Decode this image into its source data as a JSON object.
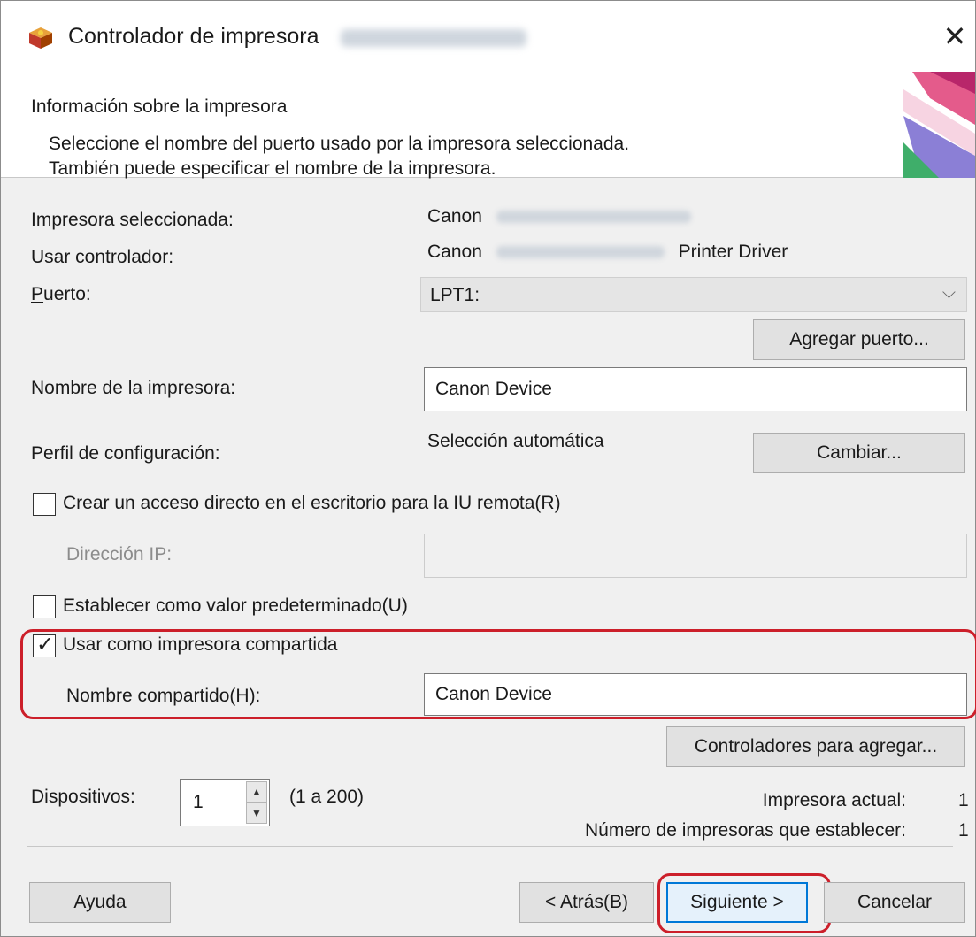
{
  "window": {
    "title": "Controlador de impresora",
    "close_glyph": "✕"
  },
  "header": {
    "title": "Información sobre la impresora",
    "desc_line1": "Seleccione el nombre del puerto usado por la impresora seleccionada.",
    "desc_line2": "También puede especificar el nombre de la impresora."
  },
  "form": {
    "selected_printer_label": "Impresora seleccionada:",
    "selected_printer_value": "Canon",
    "driver_label": "Usar controlador:",
    "driver_value_prefix": "Canon",
    "driver_value_suffix": "Printer Driver",
    "port_label": "Puerto:",
    "port_value": "LPT1:",
    "add_port_button": "Agregar puerto...",
    "printer_name_label": "Nombre de la impresora:",
    "printer_name_value": "Canon Device",
    "config_profile_label": "Perfil de configuración:",
    "config_profile_value": "Selección automática",
    "change_button": "Cambiar...",
    "shortcut_checkbox_label": "Crear un acceso directo en el escritorio para la IU remota(R)",
    "ip_label": "Dirección IP:",
    "ip_value": "",
    "default_checkbox_label": "Establecer como valor predeterminado(U)",
    "shared_checkbox_label": "Usar como impresora compartida",
    "share_name_label": "Nombre compartido(H):",
    "share_name_value": "Canon Device",
    "add_drivers_button": "Controladores para agregar...",
    "devices_label": "Dispositivos:",
    "devices_value": "1",
    "devices_range": "(1 a 200)",
    "current_printer_label": "Impresora actual:",
    "current_printer_value": "1",
    "printers_to_set_label": "Número de impresoras que establecer:",
    "printers_to_set_value": "1"
  },
  "checkboxes": {
    "shortcut_checked": false,
    "default_checked": false,
    "shared_checked": true
  },
  "buttons": {
    "help": "Ayuda",
    "back": "< Atrás(B)",
    "next": "Siguiente >",
    "cancel": "Cancelar"
  },
  "colors": {
    "highlight": "#cc1f2a",
    "default_button_border": "#0078d7"
  }
}
